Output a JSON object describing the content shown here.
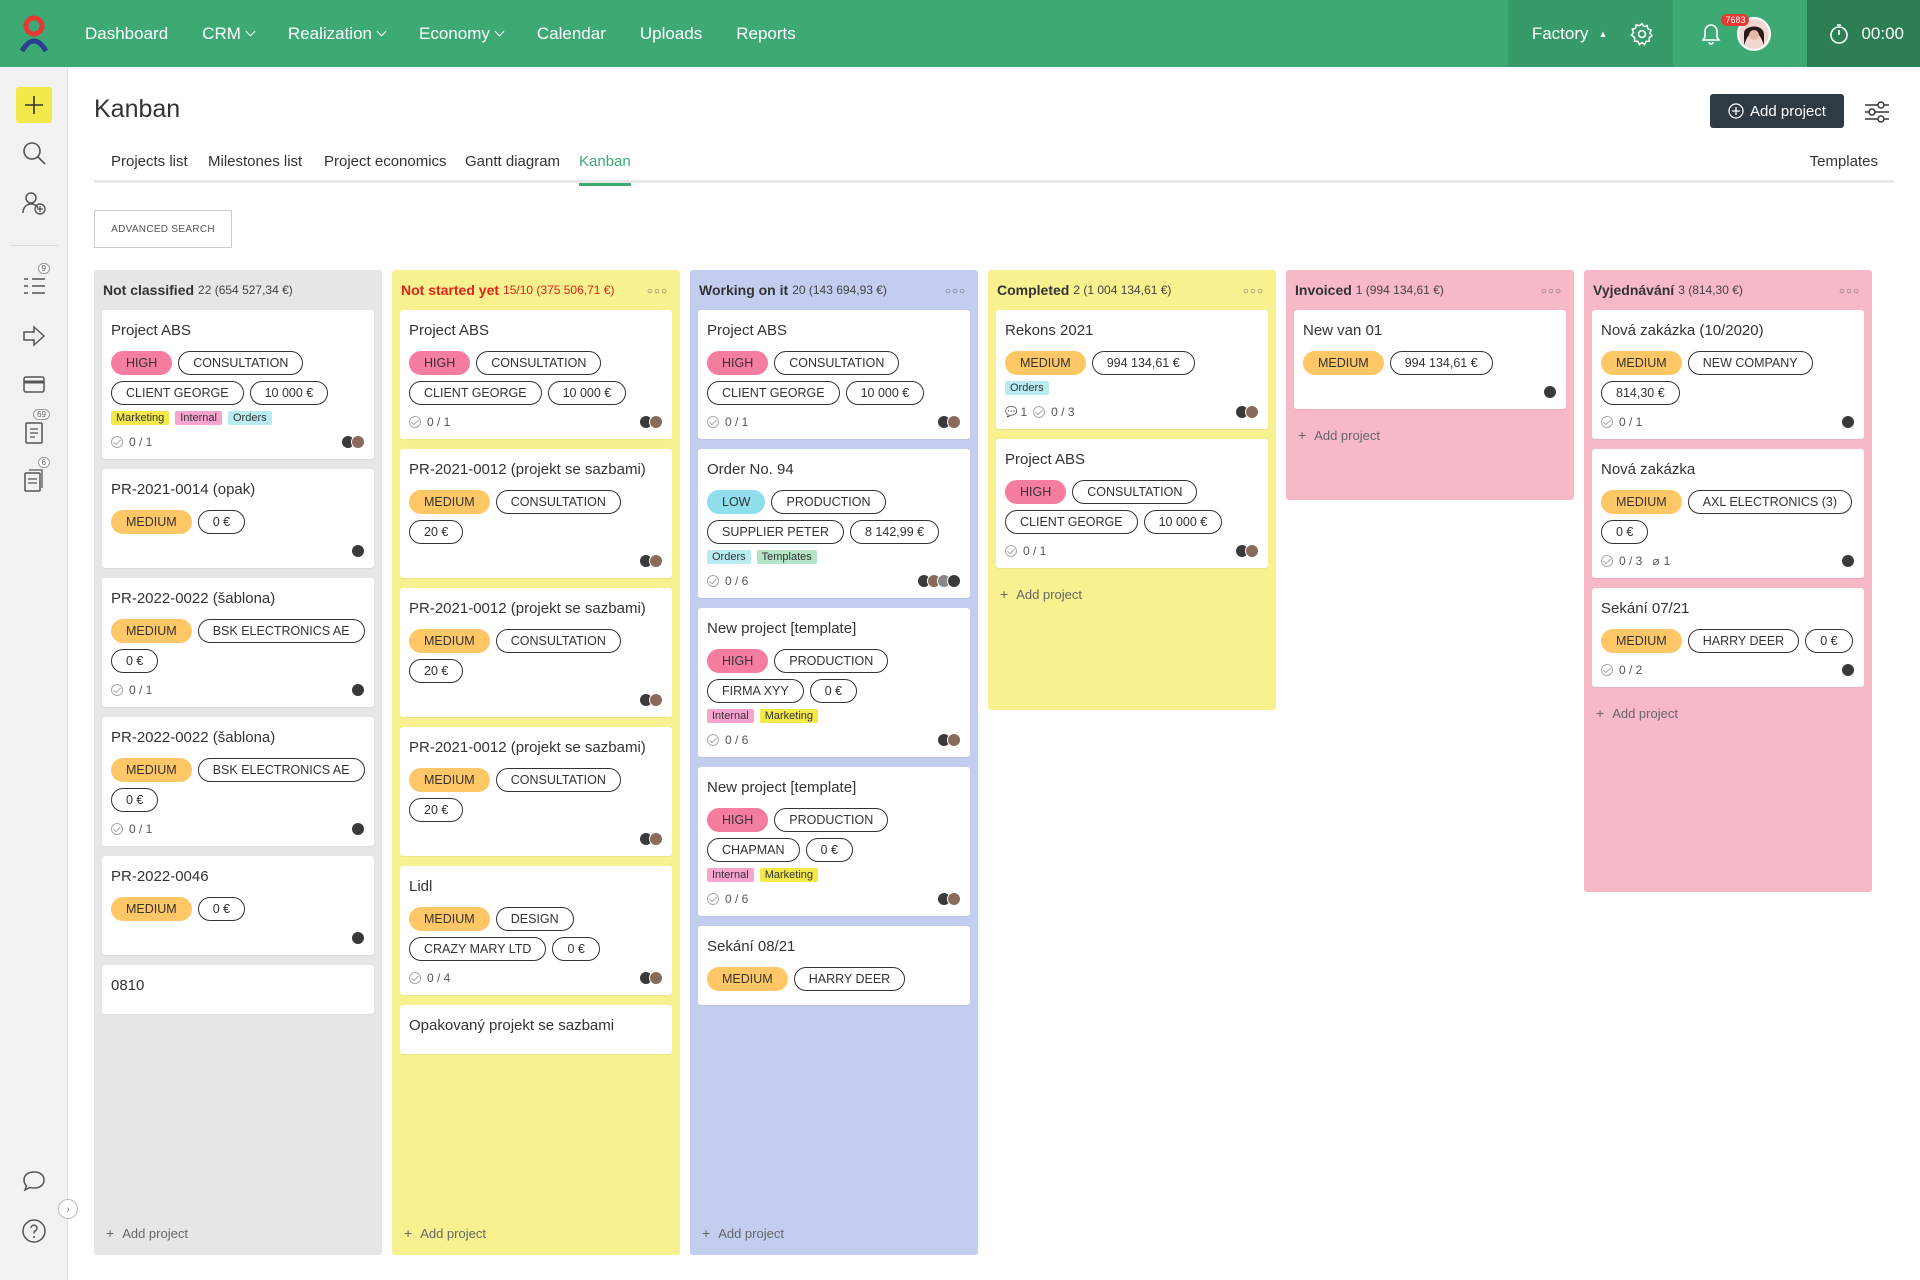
{
  "topbar": {
    "nav": [
      {
        "label": "Dashboard",
        "dropdown": false
      },
      {
        "label": "CRM",
        "dropdown": true
      },
      {
        "label": "Realization",
        "dropdown": true
      },
      {
        "label": "Economy",
        "dropdown": true
      },
      {
        "label": "Calendar",
        "dropdown": false
      },
      {
        "label": "Uploads",
        "dropdown": false
      },
      {
        "label": "Reports",
        "dropdown": false
      }
    ],
    "workspace": "Factory",
    "notifications_badge": "7683",
    "timer": "00:00"
  },
  "sidebar": {
    "badges": {
      "tasks": "9",
      "docs": "69",
      "files": "6"
    }
  },
  "page": {
    "title": "Kanban",
    "add_project_label": "Add project",
    "tabs": [
      "Projects list",
      "Milestones list",
      "Project economics",
      "Gantt diagram",
      "Kanban"
    ],
    "templates_link": "Templates",
    "advanced_search": "ADVANCED SEARCH"
  },
  "colors": {
    "accent": "#3daa74",
    "high": "#f57ea0",
    "medium": "#ffc766",
    "low": "#8fe0ec"
  },
  "columns": [
    {
      "name": "Not classified",
      "meta": "22 (654 527,34 €)",
      "color": "#e6e6e6",
      "add_label": "Add project",
      "cards": [
        {
          "title": "Project ABS",
          "tags": [
            [
              "high",
              "HIGH"
            ],
            [
              "out",
              "CONSULTATION"
            ],
            [
              "out",
              "CLIENT GEORGE"
            ],
            [
              "out",
              "10 000 €"
            ]
          ],
          "labels": [
            [
              "marketing",
              "Marketing"
            ],
            [
              "internal",
              "Internal"
            ],
            [
              "orders",
              "Orders"
            ]
          ],
          "progress": "0 / 1",
          "avatars": 2
        },
        {
          "title": "PR-2021-0014 (opak)",
          "tags": [
            [
              "medium",
              "MEDIUM"
            ],
            [
              "out",
              "0 €"
            ]
          ],
          "labels": [],
          "progress": "",
          "avatars": 1
        },
        {
          "title": "PR-2022-0022 (šablona)",
          "tags": [
            [
              "medium",
              "MEDIUM"
            ],
            [
              "out",
              "BSK ELECTRONICS AE"
            ],
            [
              "out",
              "0 €"
            ]
          ],
          "labels": [],
          "progress": "0 / 1",
          "avatars": 1
        },
        {
          "title": "PR-2022-0022 (šablona)",
          "tags": [
            [
              "medium",
              "MEDIUM"
            ],
            [
              "out",
              "BSK ELECTRONICS AE"
            ],
            [
              "out",
              "0 €"
            ]
          ],
          "labels": [],
          "progress": "0 / 1",
          "avatars": 1
        },
        {
          "title": "PR-2022-0046",
          "tags": [
            [
              "medium",
              "MEDIUM"
            ],
            [
              "out",
              "0 €"
            ]
          ],
          "labels": [],
          "progress": "",
          "avatars": 1
        },
        {
          "title": "0810",
          "tags": [],
          "labels": [],
          "progress": "",
          "avatars": 0
        }
      ]
    },
    {
      "name": "Not started yet",
      "meta": "15/10 (375 506,71 €)",
      "color": "#f7f18f",
      "title_color": "#e0241b",
      "add_label": "Add project",
      "cards": [
        {
          "title": "Project ABS",
          "tags": [
            [
              "high",
              "HIGH"
            ],
            [
              "out",
              "CONSULTATION"
            ],
            [
              "out",
              "CLIENT GEORGE"
            ],
            [
              "out",
              "10 000 €"
            ]
          ],
          "labels": [],
          "progress": "0 / 1",
          "avatars": 2
        },
        {
          "title": "PR-2021-0012 (projekt se sazbami)",
          "tags": [
            [
              "medium",
              "MEDIUM"
            ],
            [
              "out",
              "CONSULTATION"
            ],
            [
              "out",
              "20 €"
            ]
          ],
          "labels": [],
          "progress": "",
          "avatars": 2
        },
        {
          "title": "PR-2021-0012 (projekt se sazbami)",
          "tags": [
            [
              "medium",
              "MEDIUM"
            ],
            [
              "out",
              "CONSULTATION"
            ],
            [
              "out",
              "20 €"
            ]
          ],
          "labels": [],
          "progress": "",
          "avatars": 2
        },
        {
          "title": "PR-2021-0012 (projekt se sazbami)",
          "tags": [
            [
              "medium",
              "MEDIUM"
            ],
            [
              "out",
              "CONSULTATION"
            ],
            [
              "out",
              "20 €"
            ]
          ],
          "labels": [],
          "progress": "",
          "avatars": 2
        },
        {
          "title": "Lidl",
          "tags": [
            [
              "medium",
              "MEDIUM"
            ],
            [
              "out",
              "DESIGN"
            ],
            [
              "out",
              "CRAZY MARY LTD"
            ],
            [
              "out",
              "0 €"
            ]
          ],
          "labels": [],
          "progress": "0 / 4",
          "avatars": 2
        },
        {
          "title": "Opakovaný projekt se sazbami",
          "tags": [],
          "labels": [],
          "progress": "",
          "avatars": 0
        }
      ]
    },
    {
      "name": "Working on it",
      "meta": "20 (143 694,93 €)",
      "color": "#c3cdf0",
      "add_label": "Add project",
      "cards": [
        {
          "title": "Project ABS",
          "tags": [
            [
              "high",
              "HIGH"
            ],
            [
              "out",
              "CONSULTATION"
            ],
            [
              "out",
              "CLIENT GEORGE"
            ],
            [
              "out",
              "10 000 €"
            ]
          ],
          "labels": [],
          "progress": "0 / 1",
          "avatars": 2
        },
        {
          "title": "Order No. 94",
          "tags": [
            [
              "low",
              "LOW"
            ],
            [
              "out",
              "PRODUCTION"
            ],
            [
              "out",
              "SUPPLIER PETER"
            ],
            [
              "out",
              "8 142,99 €"
            ]
          ],
          "labels": [
            [
              "orders",
              "Orders"
            ],
            [
              "templates",
              "Templates"
            ]
          ],
          "progress": "0 / 6",
          "avatars": 4
        },
        {
          "title": "New project [template]",
          "tags": [
            [
              "high",
              "HIGH"
            ],
            [
              "out",
              "PRODUCTION"
            ],
            [
              "out",
              "FIRMA XYY"
            ],
            [
              "out",
              "0 €"
            ]
          ],
          "labels": [
            [
              "internal",
              "Internal"
            ],
            [
              "marketing",
              "Marketing"
            ]
          ],
          "progress": "0 / 6",
          "avatars": 2
        },
        {
          "title": "New project [template]",
          "tags": [
            [
              "high",
              "HIGH"
            ],
            [
              "out",
              "PRODUCTION"
            ],
            [
              "out",
              "CHAPMAN"
            ],
            [
              "out",
              "0 €"
            ]
          ],
          "labels": [
            [
              "internal",
              "Internal"
            ],
            [
              "marketing",
              "Marketing"
            ]
          ],
          "progress": "0 / 6",
          "avatars": 2
        },
        {
          "title": "Sekání 08/21",
          "tags": [
            [
              "medium",
              "MEDIUM"
            ],
            [
              "out",
              "HARRY DEER"
            ]
          ],
          "labels": [],
          "progress": "",
          "avatars": 0
        }
      ]
    },
    {
      "name": "Completed",
      "meta": "2 (1 004 134,61 €)",
      "color": "#f7f18f",
      "add_label": "Add project",
      "cards": [
        {
          "title": "Rekons 2021",
          "tags": [
            [
              "medium",
              "MEDIUM"
            ],
            [
              "out",
              "994 134,61 €"
            ]
          ],
          "labels": [
            [
              "orders",
              "Orders"
            ]
          ],
          "progress": "0 / 3",
          "comments": "1",
          "avatars": 2
        },
        {
          "title": "Project ABS",
          "tags": [
            [
              "high",
              "HIGH"
            ],
            [
              "out",
              "CONSULTATION"
            ],
            [
              "out",
              "CLIENT GEORGE"
            ],
            [
              "out",
              "10 000 €"
            ]
          ],
          "labels": [],
          "progress": "0 / 1",
          "avatars": 2
        }
      ]
    },
    {
      "name": "Invoiced",
      "meta": "1 (994 134,61 €)",
      "color": "#f7b8c8",
      "add_label": "Add project",
      "cards": [
        {
          "title": "New van 01",
          "tags": [
            [
              "medium",
              "MEDIUM"
            ],
            [
              "out",
              "994 134,61 €"
            ]
          ],
          "labels": [],
          "progress": "",
          "avatars": 1
        }
      ]
    },
    {
      "name": "Vyjednávání",
      "meta": "3 (814,30 €)",
      "color": "#f7b8c8",
      "add_label": "Add project",
      "cards": [
        {
          "title": "Nová zakázka (10/2020)",
          "tags": [
            [
              "medium",
              "MEDIUM"
            ],
            [
              "out",
              "NEW COMPANY"
            ],
            [
              "out",
              "814,30 €"
            ]
          ],
          "labels": [],
          "progress": "0 / 1",
          "avatars": 1
        },
        {
          "title": "Nová zakázka",
          "tags": [
            [
              "medium",
              "MEDIUM"
            ],
            [
              "out",
              "AXL ELECTRONICS (3)"
            ],
            [
              "out",
              "0 €"
            ]
          ],
          "labels": [],
          "progress": "0 / 3",
          "attachments": "1",
          "avatars": 1
        },
        {
          "title": "Sekání 07/21",
          "tags": [
            [
              "medium",
              "MEDIUM"
            ],
            [
              "out",
              "HARRY DEER"
            ],
            [
              "out",
              "0 €"
            ]
          ],
          "labels": [],
          "progress": "0 / 2",
          "avatars": 1
        }
      ]
    }
  ]
}
